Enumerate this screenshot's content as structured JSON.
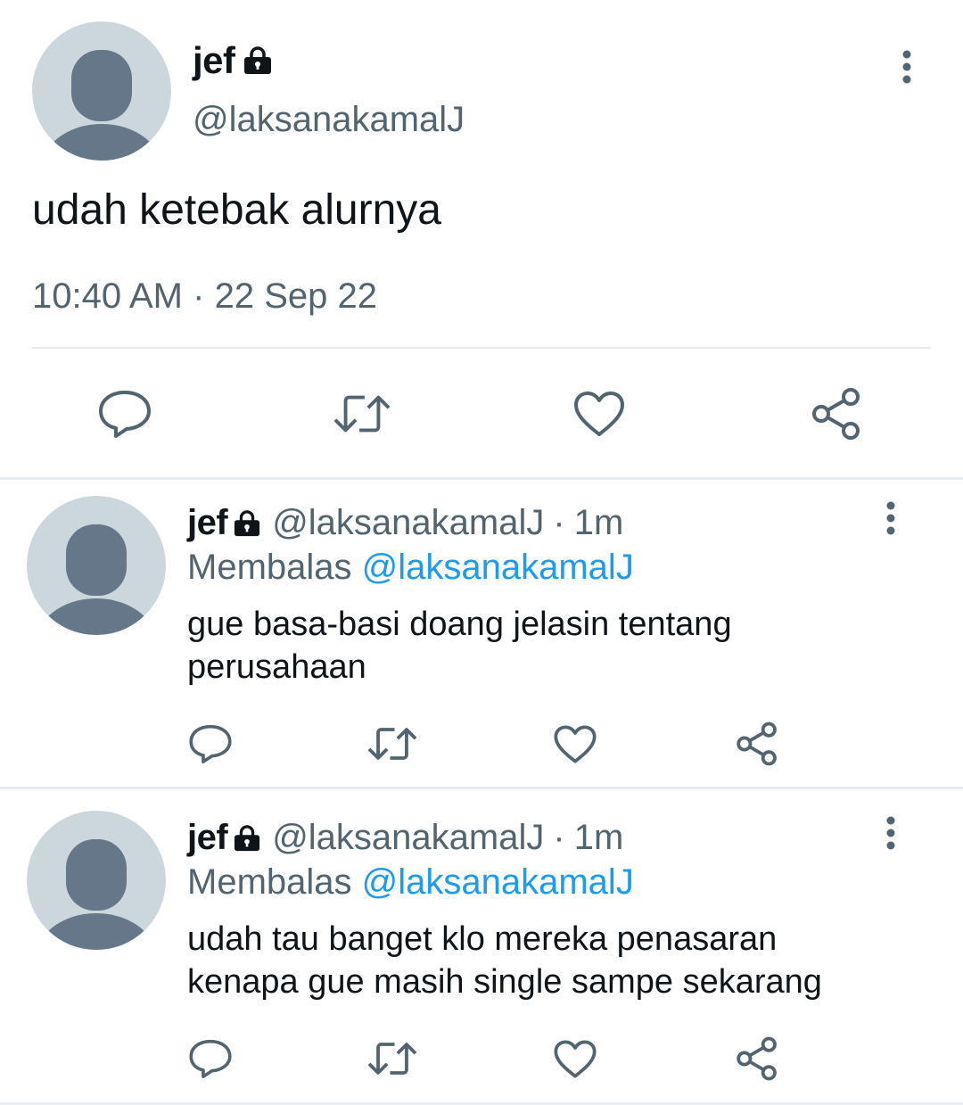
{
  "main_tweet": {
    "display_name": "jef",
    "handle": "@laksanakamalJ",
    "text": "udah ketebak alurnya",
    "time": "10:40 AM",
    "separator": "·",
    "date": "22 Sep 22",
    "icons": {
      "avatar": "default-avatar-icon",
      "lock": "lock-icon",
      "more": "more-vertical-icon",
      "reply": "reply-icon",
      "retweet": "retweet-icon",
      "like": "heart-icon",
      "share": "share-icon"
    }
  },
  "replies": [
    {
      "display_name": "jef",
      "handle": "@laksanakamalJ",
      "separator": "·",
      "age": "1m",
      "replying_label": "Membalas",
      "replying_to": "@laksanakamalJ",
      "text_lines": [
        "gue basa-basi doang jelasin tentang",
        "perusahaan"
      ]
    },
    {
      "display_name": "jef",
      "handle": "@laksanakamalJ",
      "separator": "·",
      "age": "1m",
      "replying_label": "Membalas",
      "replying_to": "@laksanakamalJ",
      "text_lines": [
        "udah tau banget klo mereka penasaran",
        "kenapa gue masih single sampe sekarang"
      ]
    }
  ],
  "colors": {
    "text_primary": "#0f1419",
    "text_secondary": "#536471",
    "link": "#1d9bf0",
    "avatar_bg": "#ccd6dd",
    "avatar_fg": "#66778a",
    "divider": "#e6ecf0"
  }
}
